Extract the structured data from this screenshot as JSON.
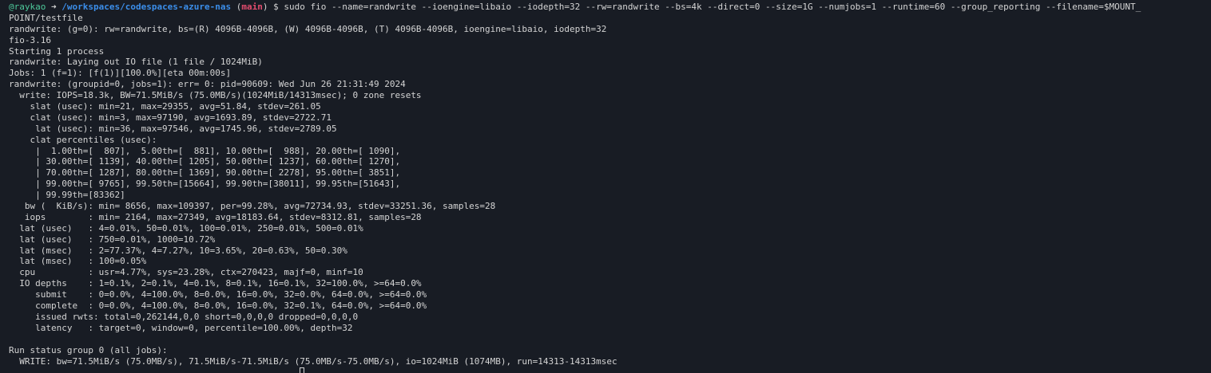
{
  "prompt": {
    "user": "@raykao",
    "arrow": "➜",
    "path": "/workspaces/codespaces-azure-nas",
    "branch_open": " (",
    "branch": "main",
    "branch_close": ")",
    "command": " $ sudo fio --name=randwrite --ioengine=libaio --iodepth=32 --rw=randwrite --bs=4k --direct=0 --size=1G --numjobs=1 --runtime=60 --group_reporting --filename=$MOUNT_"
  },
  "output_lines": [
    "POINT/testfile",
    "randwrite: (g=0): rw=randwrite, bs=(R) 4096B-4096B, (W) 4096B-4096B, (T) 4096B-4096B, ioengine=libaio, iodepth=32",
    "fio-3.16",
    "Starting 1 process",
    "randwrite: Laying out IO file (1 file / 1024MiB)",
    "Jobs: 1 (f=1): [f(1)][100.0%][eta 00m:00s]",
    "randwrite: (groupid=0, jobs=1): err= 0: pid=90609: Wed Jun 26 21:31:49 2024",
    "  write: IOPS=18.3k, BW=71.5MiB/s (75.0MB/s)(1024MiB/14313msec); 0 zone resets",
    "    slat (usec): min=21, max=29355, avg=51.84, stdev=261.05",
    "    clat (usec): min=3, max=97190, avg=1693.89, stdev=2722.71",
    "     lat (usec): min=36, max=97546, avg=1745.96, stdev=2789.05",
    "    clat percentiles (usec):",
    "     |  1.00th=[  807],  5.00th=[  881], 10.00th=[  988], 20.00th=[ 1090],",
    "     | 30.00th=[ 1139], 40.00th=[ 1205], 50.00th=[ 1237], 60.00th=[ 1270],",
    "     | 70.00th=[ 1287], 80.00th=[ 1369], 90.00th=[ 2278], 95.00th=[ 3851],",
    "     | 99.00th=[ 9765], 99.50th=[15664], 99.90th=[38011], 99.95th=[51643],",
    "     | 99.99th=[83362]",
    "   bw (  KiB/s): min= 8656, max=109397, per=99.28%, avg=72734.93, stdev=33251.36, samples=28",
    "   iops        : min= 2164, max=27349, avg=18183.64, stdev=8312.81, samples=28",
    "  lat (usec)   : 4=0.01%, 50=0.01%, 100=0.01%, 250=0.01%, 500=0.01%",
    "  lat (usec)   : 750=0.01%, 1000=10.72%",
    "  lat (msec)   : 2=77.37%, 4=7.27%, 10=3.65%, 20=0.63%, 50=0.30%",
    "  lat (msec)   : 100=0.05%",
    "  cpu          : usr=4.77%, sys=23.28%, ctx=270423, majf=0, minf=10",
    "  IO depths    : 1=0.1%, 2=0.1%, 4=0.1%, 8=0.1%, 16=0.1%, 32=100.0%, >=64=0.0%",
    "     submit    : 0=0.0%, 4=100.0%, 8=0.0%, 16=0.0%, 32=0.0%, 64=0.0%, >=64=0.0%",
    "     complete  : 0=0.0%, 4=100.0%, 8=0.0%, 16=0.0%, 32=0.1%, 64=0.0%, >=64=0.0%",
    "     issued rwts: total=0,262144,0,0 short=0,0,0,0 dropped=0,0,0,0",
    "     latency   : target=0, window=0, percentile=100.00%, depth=32",
    "",
    "Run status group 0 (all jobs):",
    "  WRITE: bw=71.5MiB/s (75.0MB/s), 71.5MiB/s-71.5MiB/s (75.0MB/s-75.0MB/s), io=1024MiB (1074MB), run=14313-14313msec"
  ]
}
